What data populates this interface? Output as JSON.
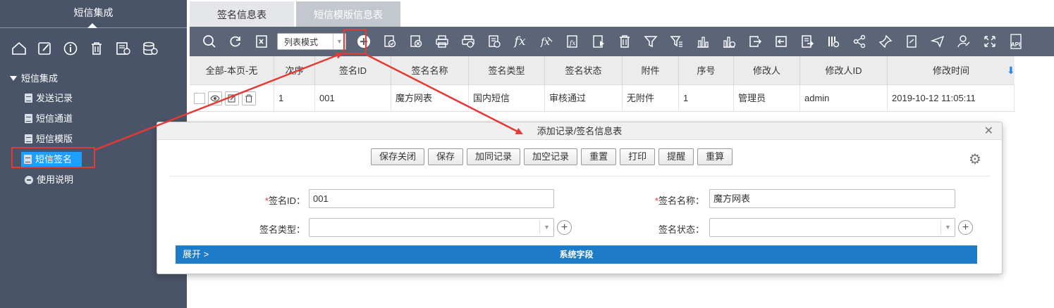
{
  "sidebar": {
    "title": "短信集成",
    "icons": [
      "home-icon",
      "edit-icon",
      "info-icon",
      "trash-icon",
      "export-icon",
      "database-icon"
    ],
    "root": "短信集成",
    "items": [
      {
        "label": "发送记录"
      },
      {
        "label": "短信通道"
      },
      {
        "label": "短信模版"
      },
      {
        "label": "短信签名"
      },
      {
        "label": "使用说明"
      }
    ]
  },
  "tabs": [
    {
      "label": "签名信息表"
    },
    {
      "label": "短信模版信息表"
    }
  ],
  "toolbar": {
    "mode": "列表模式",
    "fx1": "fx",
    "api": "API"
  },
  "table": {
    "columns": [
      "全部-本页-无",
      "次序",
      "签名ID",
      "签名名称",
      "签名类型",
      "签名状态",
      "附件",
      "序号",
      "修改人",
      "修改人ID",
      "修改时间"
    ],
    "rows": [
      [
        "",
        "1",
        "001",
        "魔方网表",
        "国内短信",
        "审核通过",
        "无附件",
        "1",
        "管理员",
        "admin",
        "2019-10-12 11:05:11"
      ]
    ]
  },
  "dialog": {
    "title": "添加记录/签名信息表",
    "buttons": [
      "保存关闭",
      "保存",
      "加同记录",
      "加空记录",
      "重置",
      "打印",
      "提醒",
      "重算"
    ],
    "fields": {
      "sign_id_label": "签名ID：",
      "sign_id_value": "001",
      "sign_name_label": "签名名称：",
      "sign_name_value": "魔方网表",
      "sign_type_label": "签名类型：",
      "sign_status_label": "签名状态："
    },
    "expand": "展开 >",
    "system_fields": "系统字段"
  },
  "colors": {
    "sidebar_bg": "#4a5468",
    "toolbar_bg": "#5c6478",
    "active_item": "#1e9fff",
    "annotation": "#e53935",
    "system_bar": "#1e7bc8"
  }
}
